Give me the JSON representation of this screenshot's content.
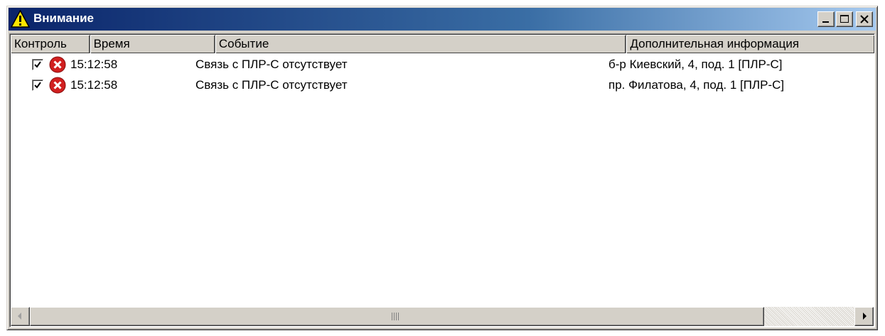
{
  "window": {
    "title": "Внимание",
    "title_icon": "warning-icon",
    "buttons": [
      "minimize",
      "maximize",
      "close"
    ]
  },
  "columns": [
    {
      "label": "Контроль"
    },
    {
      "label": "Время"
    },
    {
      "label": "Событие"
    },
    {
      "label": "Дополнительная информация"
    }
  ],
  "rows": [
    {
      "checked": true,
      "status_icon": "error-icon",
      "time": "15:12:58",
      "event": "Связь с ПЛР-С отсутствует",
      "info": "б-р Киевский, 4, под. 1 [ПЛР-С]"
    },
    {
      "checked": true,
      "status_icon": "error-icon",
      "time": "15:12:58",
      "event": "Связь с ПЛР-С отсутствует",
      "info": "пр. Филатова, 4, под. 1 [ПЛР-С]"
    }
  ],
  "colors": {
    "title_gradient_start": "#0a246a",
    "title_gradient_end": "#a6caf0",
    "error_red": "#d11f1f",
    "face": "#d4d0c8"
  }
}
